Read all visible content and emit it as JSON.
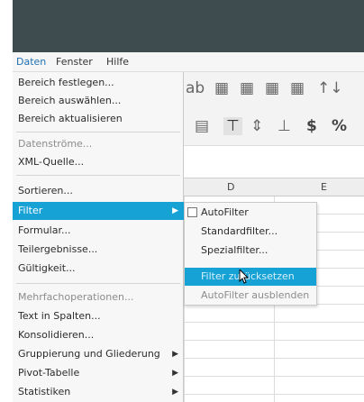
{
  "menubar": {
    "daten": "Daten",
    "fenster": "Fenster",
    "hilfe": "Hilfe"
  },
  "toolbar": {
    "row1_icons": [
      "ab",
      "▦",
      "▦",
      "▦",
      "▦",
      "↑↓"
    ],
    "row2_icons": [
      "▤",
      "⊤",
      "⇕",
      "⊥",
      "$",
      "%"
    ]
  },
  "columns": [
    "D",
    "E"
  ],
  "daten_menu": [
    {
      "label": "Bereich festlegen...",
      "disabled": false
    },
    {
      "label": "Bereich auswählen...",
      "disabled": false
    },
    {
      "label": "Bereich aktualisieren",
      "disabled": false
    },
    {
      "label": "Datenströme...",
      "disabled": true
    },
    {
      "label": "XML-Quelle...",
      "disabled": false
    },
    {
      "label": "Sortieren...",
      "disabled": false
    },
    {
      "label": "Filter",
      "disabled": false,
      "submenu": true,
      "active": true
    },
    {
      "label": "Formular...",
      "disabled": false
    },
    {
      "label": "Teilergebnisse...",
      "disabled": false
    },
    {
      "label": "Gültigkeit...",
      "disabled": false
    },
    {
      "label": "Mehrfachoperationen...",
      "disabled": true
    },
    {
      "label": "Text in Spalten...",
      "disabled": false
    },
    {
      "label": "Konsolidieren...",
      "disabled": false
    },
    {
      "label": "Gruppierung und Gliederung",
      "disabled": false,
      "submenu": true
    },
    {
      "label": "Pivot-Tabelle",
      "disabled": false,
      "submenu": true
    },
    {
      "label": "Statistiken",
      "disabled": false,
      "submenu": true
    }
  ],
  "filter_submenu": [
    {
      "label": "AutoFilter",
      "checkbox": true
    },
    {
      "label": "Standardfilter..."
    },
    {
      "label": "Spezialfilter..."
    },
    {
      "label": "Filter zurücksetzen",
      "active": true
    },
    {
      "label": "AutoFilter ausblenden",
      "disabled": true
    }
  ],
  "colors": {
    "titlebar": "#3e4b4f",
    "highlight": "#17a2d6"
  }
}
